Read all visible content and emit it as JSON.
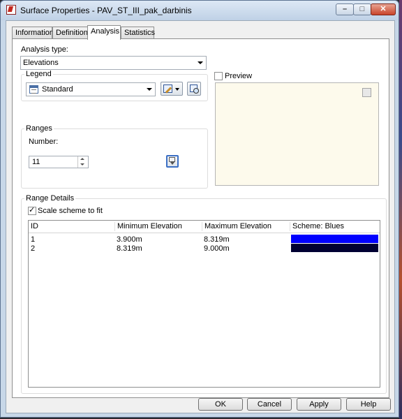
{
  "window": {
    "title": "Surface Properties - PAV_ST_III_pak_darbinis",
    "minimize_glyph": "–",
    "maximize_glyph": "□",
    "close_glyph": "✕"
  },
  "tabs": [
    {
      "label": "Information",
      "active": false
    },
    {
      "label": "Definition",
      "active": false
    },
    {
      "label": "Analysis",
      "active": true
    },
    {
      "label": "Statistics",
      "active": false
    }
  ],
  "analysis": {
    "type_label": "Analysis type:",
    "type_value": "Elevations"
  },
  "legend": {
    "group_label": "Legend",
    "style_value": "Standard"
  },
  "ranges": {
    "group_label": "Ranges",
    "number_label": "Number:",
    "number_value": "11"
  },
  "preview": {
    "label": "Preview",
    "checked": false
  },
  "range_details": {
    "group_label": "Range Details",
    "scale_label": "Scale scheme to fit",
    "scale_checked": true,
    "columns": [
      "ID",
      "Minimum Elevation",
      "Maximum Elevation",
      "Scheme: Blues"
    ],
    "rows": [
      {
        "id": "1",
        "min": "3.900m",
        "max": "8.319m",
        "color": "#0000ff"
      },
      {
        "id": "2",
        "min": "8.319m",
        "max": "9.000m",
        "color": "#000033"
      }
    ]
  },
  "buttons": {
    "ok": "OK",
    "cancel": "Cancel",
    "apply": "Apply",
    "help": "Help"
  },
  "colors": {
    "titlebar": "#c7d7e8",
    "preview_bg": "#fdfaec",
    "close_button": "#c9442a"
  },
  "icons": {
    "app": "civil3d-surface-icon",
    "legend_style": "legend-table-icon",
    "legend_edit": "edit-style-icon",
    "legend_preview": "preview-style-icon",
    "calculate": "calculate-ranges-icon"
  }
}
